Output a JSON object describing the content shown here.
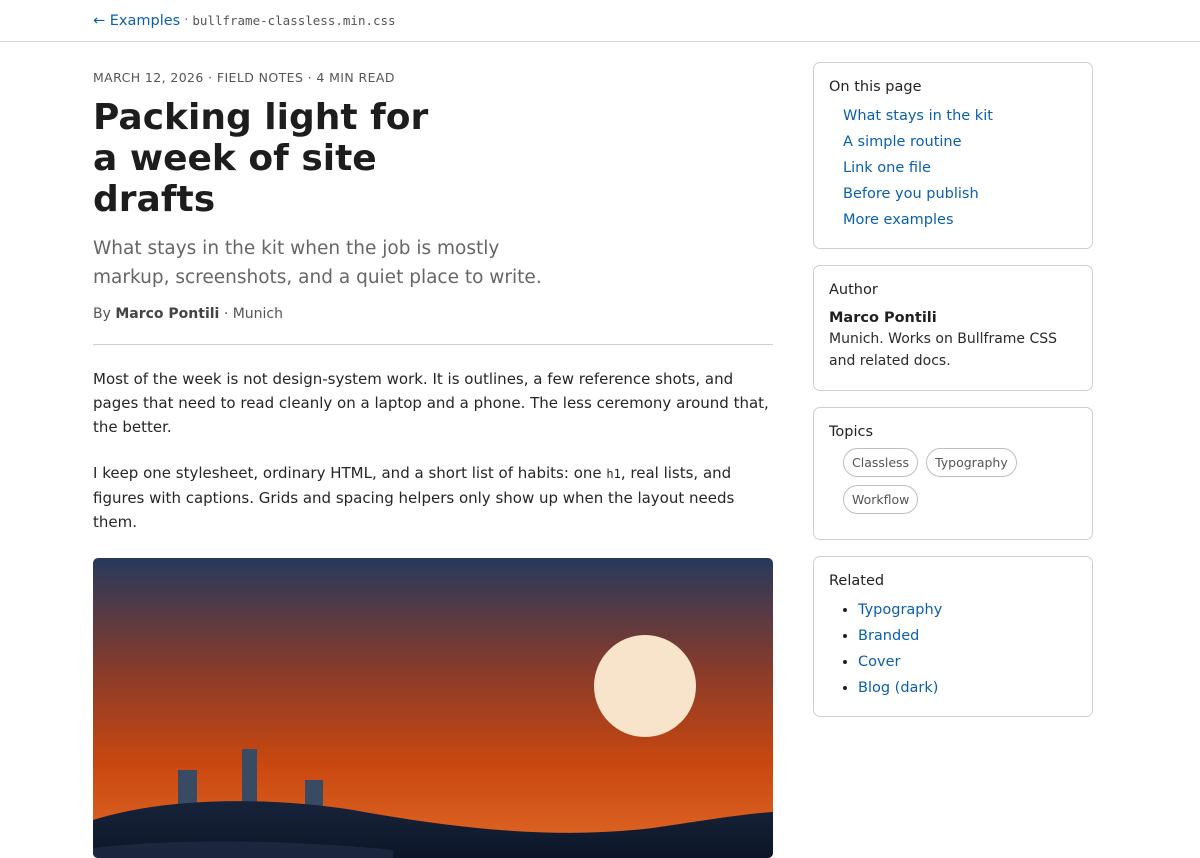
{
  "nav": {
    "back": "← Examples",
    "sep": "·",
    "file": "bullframe-classless.min.css"
  },
  "article": {
    "meta": "MARCH 12, 2026 · FIELD NOTES · 4 MIN READ",
    "title": "Packing light for a week of site drafts",
    "subtitle": "What stays in the kit when the job is mostly markup, screenshots, and a quiet place to write.",
    "byline_prefix": "By",
    "author": "Marco Pontili",
    "location": "· Munich",
    "p1": "Most of the week is not design-system work. It is outlines, a few reference shots, and pages that need to read cleanly on a laptop and a phone. The less ceremony around that, the better.",
    "p2_pre": "I keep one stylesheet, ordinary HTML, and a short list of habits: one",
    "p2_code": "h1",
    "p2_post": ", real lists, and figures with captions. Grids and spacing helpers only show up when the layout needs them."
  },
  "figure": {
    "colors": {
      "sky_top": "#263a5c",
      "sky_mid": "#8a3b2a",
      "sky_low": "#c8470f",
      "sun": "#f8e3cb",
      "ground": "#16223a",
      "pillars": "#394a63",
      "glow": "#e16a28"
    }
  },
  "sidebar": {
    "toc": {
      "title": "On this page",
      "items": [
        "What stays in the kit",
        "A simple routine",
        "Link one file",
        "Before you publish",
        "More examples"
      ]
    },
    "author": {
      "title": "Author",
      "name": "Marco Pontili",
      "bio": "Munich. Works on Bullframe CSS and related docs."
    },
    "topics": {
      "title": "Topics",
      "items": [
        "Classless",
        "Typography",
        "Workflow"
      ]
    },
    "related": {
      "title": "Related",
      "items": [
        "Typography",
        "Branded",
        "Cover",
        "Blog (dark)"
      ]
    }
  },
  "colors": {
    "link": "#0a5fad",
    "text": "#222222",
    "muted": "#666666",
    "border": "#cfcfcf"
  }
}
